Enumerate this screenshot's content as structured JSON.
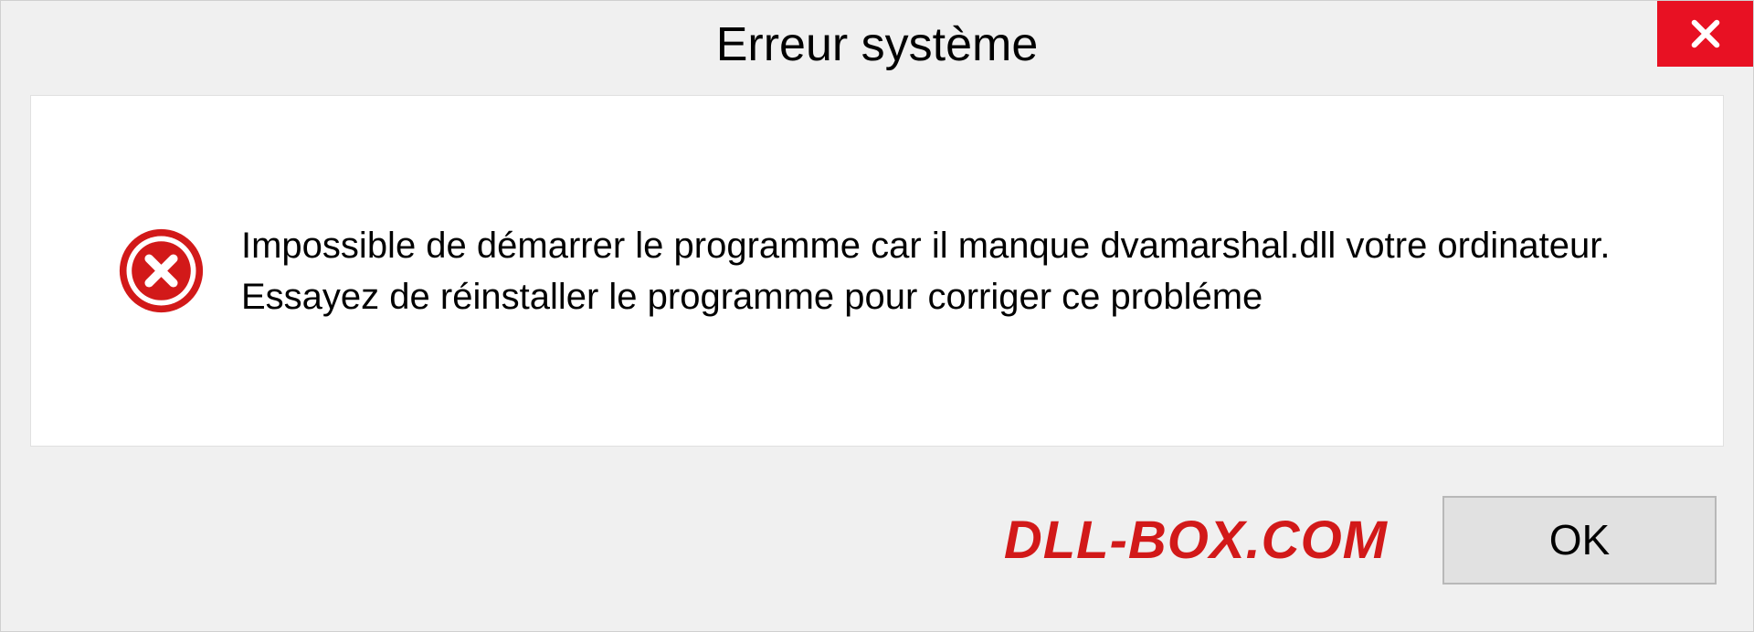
{
  "dialog": {
    "title": "Erreur système",
    "message": "Impossible de démarrer le programme car il manque dvamarshal.dll votre ordinateur. Essayez de réinstaller le programme pour corriger ce probléme",
    "watermark": "DLL-BOX.COM",
    "ok_label": "OK"
  }
}
